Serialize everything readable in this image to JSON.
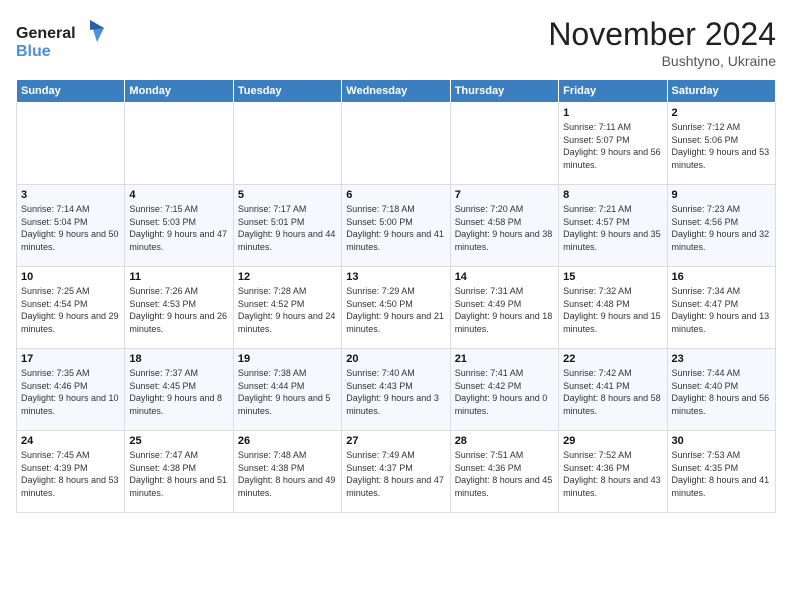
{
  "logo": {
    "line1": "General",
    "line2": "Blue"
  },
  "header": {
    "month": "November 2024",
    "location": "Bushtyno, Ukraine"
  },
  "weekdays": [
    "Sunday",
    "Monday",
    "Tuesday",
    "Wednesday",
    "Thursday",
    "Friday",
    "Saturday"
  ],
  "weeks": [
    [
      {
        "day": "",
        "info": ""
      },
      {
        "day": "",
        "info": ""
      },
      {
        "day": "",
        "info": ""
      },
      {
        "day": "",
        "info": ""
      },
      {
        "day": "",
        "info": ""
      },
      {
        "day": "1",
        "info": "Sunrise: 7:11 AM\nSunset: 5:07 PM\nDaylight: 9 hours and 56 minutes."
      },
      {
        "day": "2",
        "info": "Sunrise: 7:12 AM\nSunset: 5:06 PM\nDaylight: 9 hours and 53 minutes."
      }
    ],
    [
      {
        "day": "3",
        "info": "Sunrise: 7:14 AM\nSunset: 5:04 PM\nDaylight: 9 hours and 50 minutes."
      },
      {
        "day": "4",
        "info": "Sunrise: 7:15 AM\nSunset: 5:03 PM\nDaylight: 9 hours and 47 minutes."
      },
      {
        "day": "5",
        "info": "Sunrise: 7:17 AM\nSunset: 5:01 PM\nDaylight: 9 hours and 44 minutes."
      },
      {
        "day": "6",
        "info": "Sunrise: 7:18 AM\nSunset: 5:00 PM\nDaylight: 9 hours and 41 minutes."
      },
      {
        "day": "7",
        "info": "Sunrise: 7:20 AM\nSunset: 4:58 PM\nDaylight: 9 hours and 38 minutes."
      },
      {
        "day": "8",
        "info": "Sunrise: 7:21 AM\nSunset: 4:57 PM\nDaylight: 9 hours and 35 minutes."
      },
      {
        "day": "9",
        "info": "Sunrise: 7:23 AM\nSunset: 4:56 PM\nDaylight: 9 hours and 32 minutes."
      }
    ],
    [
      {
        "day": "10",
        "info": "Sunrise: 7:25 AM\nSunset: 4:54 PM\nDaylight: 9 hours and 29 minutes."
      },
      {
        "day": "11",
        "info": "Sunrise: 7:26 AM\nSunset: 4:53 PM\nDaylight: 9 hours and 26 minutes."
      },
      {
        "day": "12",
        "info": "Sunrise: 7:28 AM\nSunset: 4:52 PM\nDaylight: 9 hours and 24 minutes."
      },
      {
        "day": "13",
        "info": "Sunrise: 7:29 AM\nSunset: 4:50 PM\nDaylight: 9 hours and 21 minutes."
      },
      {
        "day": "14",
        "info": "Sunrise: 7:31 AM\nSunset: 4:49 PM\nDaylight: 9 hours and 18 minutes."
      },
      {
        "day": "15",
        "info": "Sunrise: 7:32 AM\nSunset: 4:48 PM\nDaylight: 9 hours and 15 minutes."
      },
      {
        "day": "16",
        "info": "Sunrise: 7:34 AM\nSunset: 4:47 PM\nDaylight: 9 hours and 13 minutes."
      }
    ],
    [
      {
        "day": "17",
        "info": "Sunrise: 7:35 AM\nSunset: 4:46 PM\nDaylight: 9 hours and 10 minutes."
      },
      {
        "day": "18",
        "info": "Sunrise: 7:37 AM\nSunset: 4:45 PM\nDaylight: 9 hours and 8 minutes."
      },
      {
        "day": "19",
        "info": "Sunrise: 7:38 AM\nSunset: 4:44 PM\nDaylight: 9 hours and 5 minutes."
      },
      {
        "day": "20",
        "info": "Sunrise: 7:40 AM\nSunset: 4:43 PM\nDaylight: 9 hours and 3 minutes."
      },
      {
        "day": "21",
        "info": "Sunrise: 7:41 AM\nSunset: 4:42 PM\nDaylight: 9 hours and 0 minutes."
      },
      {
        "day": "22",
        "info": "Sunrise: 7:42 AM\nSunset: 4:41 PM\nDaylight: 8 hours and 58 minutes."
      },
      {
        "day": "23",
        "info": "Sunrise: 7:44 AM\nSunset: 4:40 PM\nDaylight: 8 hours and 56 minutes."
      }
    ],
    [
      {
        "day": "24",
        "info": "Sunrise: 7:45 AM\nSunset: 4:39 PM\nDaylight: 8 hours and 53 minutes."
      },
      {
        "day": "25",
        "info": "Sunrise: 7:47 AM\nSunset: 4:38 PM\nDaylight: 8 hours and 51 minutes."
      },
      {
        "day": "26",
        "info": "Sunrise: 7:48 AM\nSunset: 4:38 PM\nDaylight: 8 hours and 49 minutes."
      },
      {
        "day": "27",
        "info": "Sunrise: 7:49 AM\nSunset: 4:37 PM\nDaylight: 8 hours and 47 minutes."
      },
      {
        "day": "28",
        "info": "Sunrise: 7:51 AM\nSunset: 4:36 PM\nDaylight: 8 hours and 45 minutes."
      },
      {
        "day": "29",
        "info": "Sunrise: 7:52 AM\nSunset: 4:36 PM\nDaylight: 8 hours and 43 minutes."
      },
      {
        "day": "30",
        "info": "Sunrise: 7:53 AM\nSunset: 4:35 PM\nDaylight: 8 hours and 41 minutes."
      }
    ]
  ]
}
